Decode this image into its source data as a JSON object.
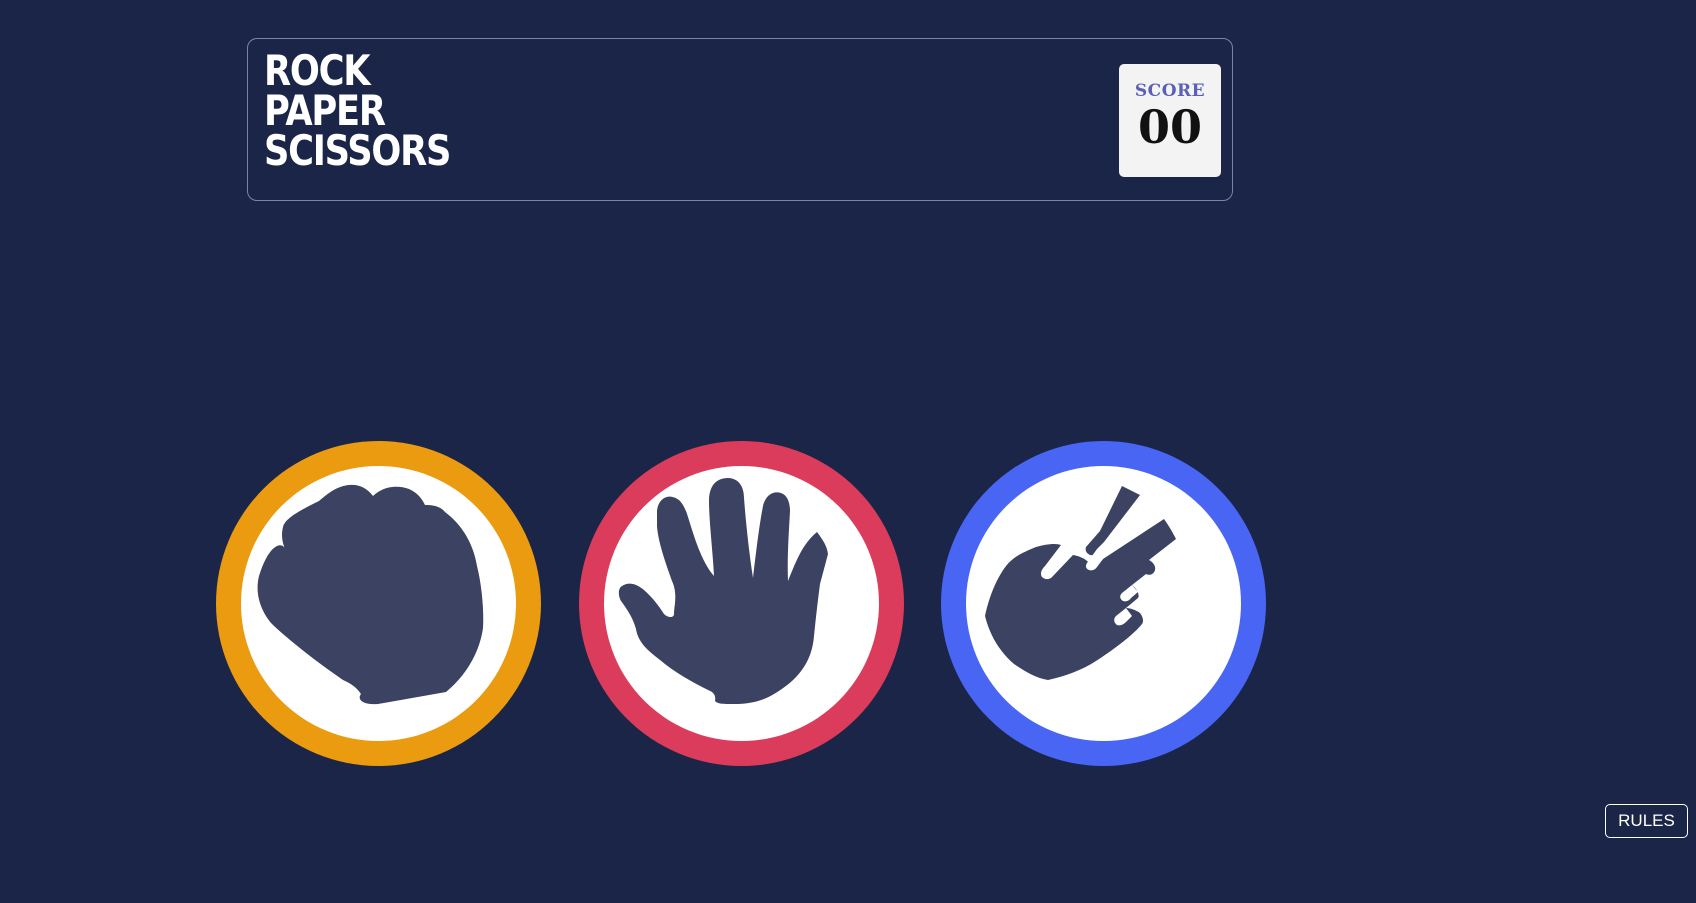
{
  "game": {
    "title_lines": [
      "ROCK",
      "PAPER",
      "SCISSORS"
    ]
  },
  "score": {
    "label": "SCORE",
    "value": "00"
  },
  "choices": [
    {
      "name": "rock",
      "icon": "rock-hand-icon",
      "color": "#eb9b0f"
    },
    {
      "name": "paper",
      "icon": "paper-hand-icon",
      "color": "#dc3c5b"
    },
    {
      "name": "scissors",
      "icon": "scissors-hand-icon",
      "color": "#4965f4"
    }
  ],
  "rules": {
    "label": "RULES"
  },
  "colors": {
    "background": "#1b2548",
    "hand": "#3b4262",
    "score_label": "#5b5fb8"
  }
}
